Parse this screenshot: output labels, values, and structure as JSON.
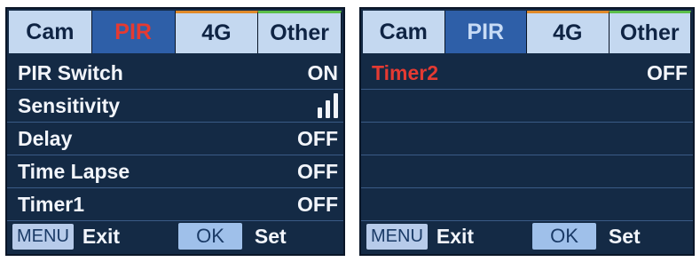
{
  "left_screen": {
    "tabs": [
      "Cam",
      "PIR",
      "4G",
      "Other"
    ],
    "active_tab": "PIR",
    "rows": [
      {
        "label": "PIR Switch",
        "value": "ON"
      },
      {
        "label": "Sensitivity",
        "value_icon": "signal-bars-icon",
        "value_level": 3
      },
      {
        "label": "Delay",
        "value": "OFF"
      },
      {
        "label": "Time Lapse",
        "value": "OFF"
      },
      {
        "label": "Timer1",
        "value": "OFF"
      }
    ],
    "footer": {
      "menu_key": "MENU",
      "exit_label": "Exit",
      "ok_key": "OK",
      "set_label": "Set"
    }
  },
  "right_screen": {
    "tabs": [
      "Cam",
      "PIR",
      "4G",
      "Other"
    ],
    "active_tab": "PIR",
    "rows": [
      {
        "label": "Timer2",
        "value": "OFF",
        "highlighted": true
      }
    ],
    "footer": {
      "menu_key": "MENU",
      "exit_label": "Exit",
      "ok_key": "OK",
      "set_label": "Set"
    }
  },
  "colors": {
    "screen_bg": "#142a45",
    "tab_bg": "#c4d8f0",
    "active_tab_bg": "#2e5fa8",
    "highlight_text": "#e53a32",
    "tab_4g_accent": "#e08a2a",
    "tab_other_accent": "#5bbf4a"
  }
}
